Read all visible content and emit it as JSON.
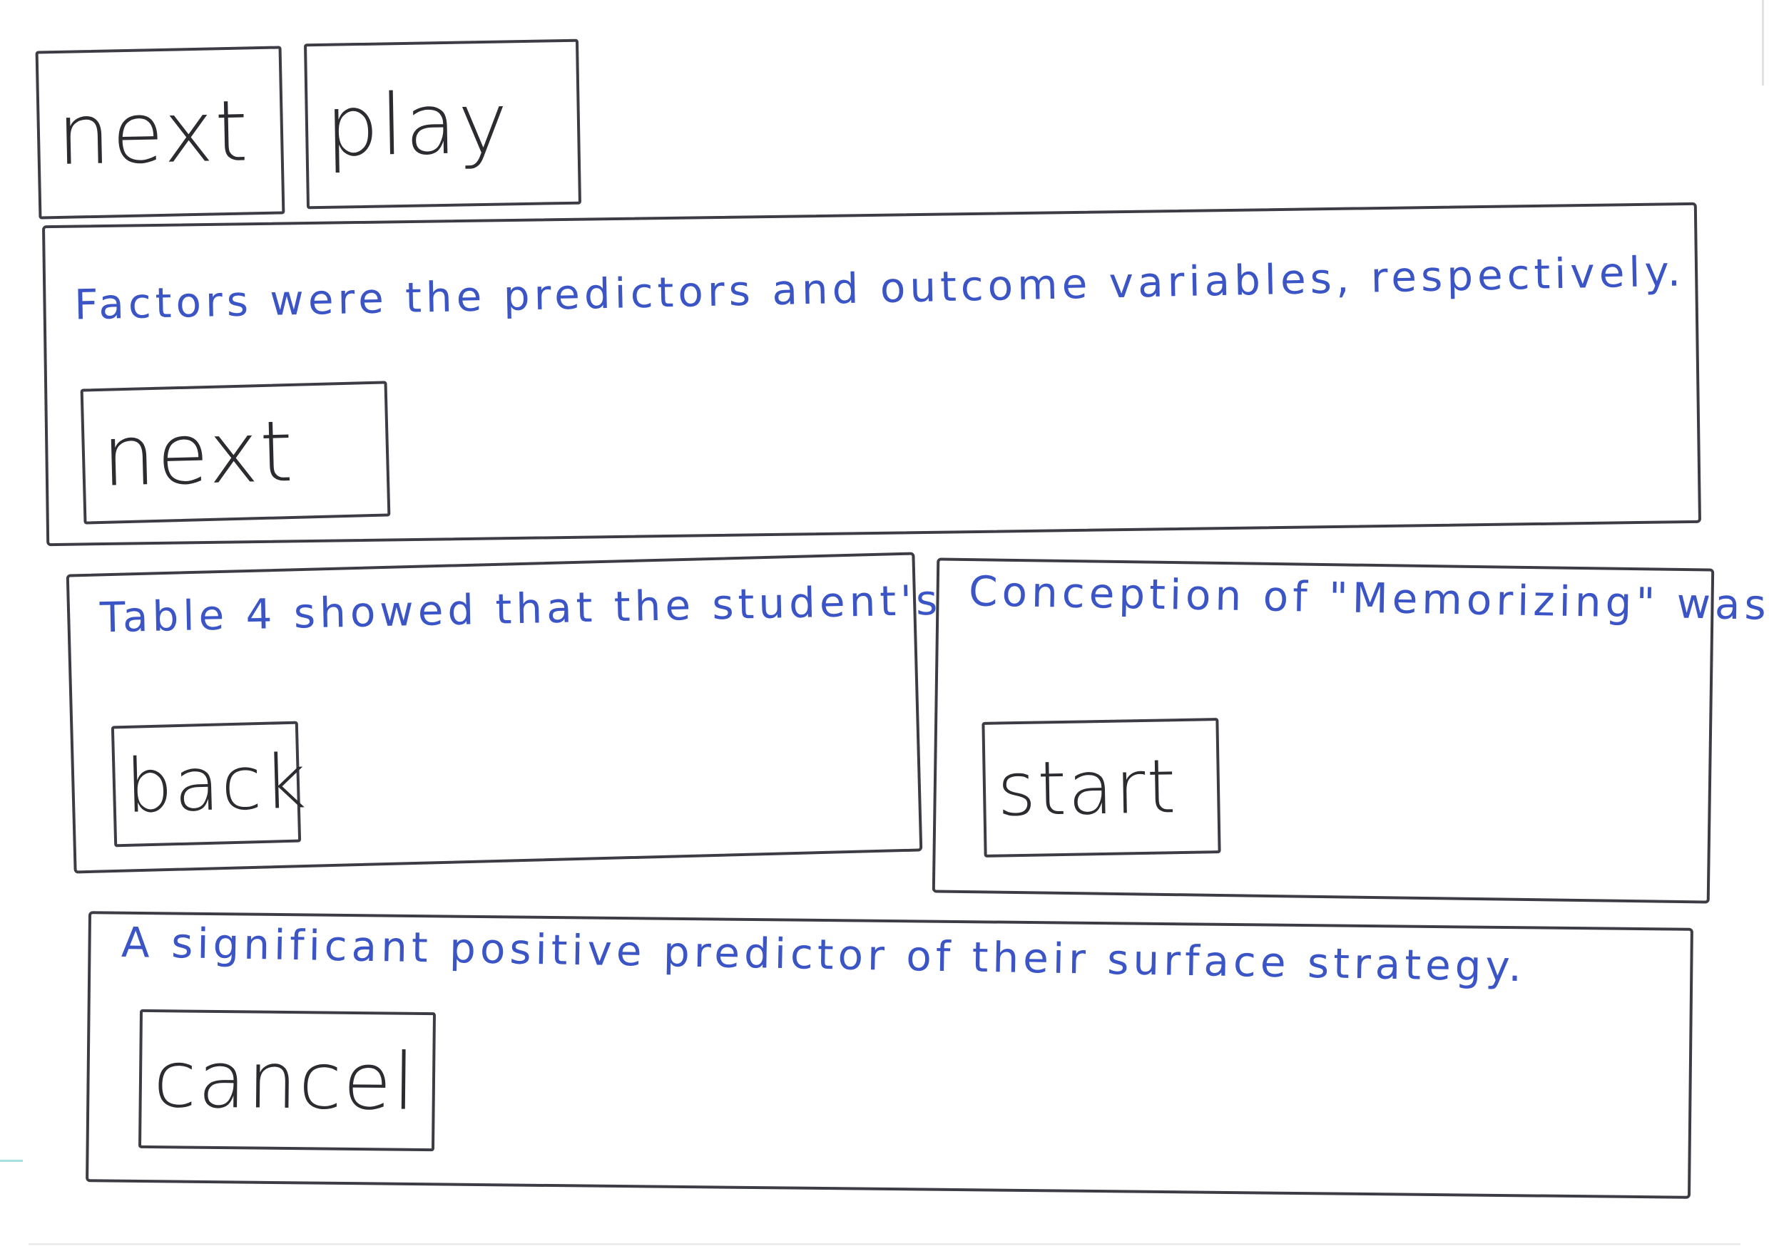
{
  "top_bar": {
    "next_label": "next",
    "play_label": "play"
  },
  "panels": [
    {
      "text": "Factors were the predictors and outcome variables, respectively.",
      "button_label": "next"
    },
    {
      "text": "Table 4 showed that the student's",
      "button_label": "back"
    },
    {
      "text": "Conception of \"Memorizing\" was",
      "button_label": "start"
    },
    {
      "text": "A significant positive predictor of their surface strategy.",
      "button_label": "cancel"
    }
  ],
  "colors": {
    "stroke": "#3c3c44",
    "annotation_text": "#3b55c6",
    "background": "#ffffff"
  }
}
